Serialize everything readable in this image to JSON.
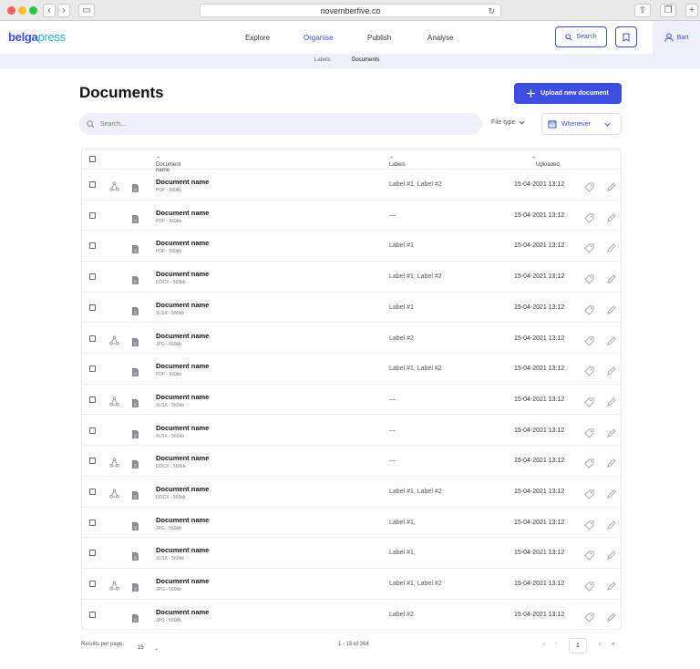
{
  "browser": {
    "url": "novemberfive.co"
  },
  "brand": {
    "part1": "belga",
    "part2": "press"
  },
  "nav": {
    "items": [
      "Explore",
      "Organise",
      "Publish",
      "Analyse"
    ],
    "active": "Organise",
    "search_label": "Search",
    "user": "Bart"
  },
  "subnav": {
    "items": [
      "Labels",
      "Documents"
    ],
    "active": "Documents"
  },
  "page": {
    "title": "Documents",
    "upload_label": "Upload new document",
    "search_placeholder": "Search...",
    "filetype_label": "File type",
    "date_filter": "Whenever"
  },
  "table": {
    "headers": {
      "name": "Document name",
      "labels": "Labels",
      "uploaded": "Uploaded"
    },
    "rows": [
      {
        "name": "Document name",
        "meta": "PDF - 560kb",
        "labels": "Label #1, Label #2",
        "date": "15-04-2021 13:12",
        "shared": true
      },
      {
        "name": "Document name",
        "meta": "PDF - 560kb",
        "labels": "—",
        "date": "15-04-2021 13:12",
        "shared": false
      },
      {
        "name": "Document name",
        "meta": "PDF - 560kb",
        "labels": "Label #1",
        "date": "15-04-2021 13:12",
        "shared": false
      },
      {
        "name": "Document name",
        "meta": "DOCX - 560kb",
        "labels": "Label #1, Label #2",
        "date": "15-04-2021 13:12",
        "shared": false
      },
      {
        "name": "Document name",
        "meta": "XLSX - 560kb",
        "labels": "Label #1",
        "date": "15-04-2021 13:12",
        "shared": false
      },
      {
        "name": "Document name",
        "meta": "JPG - 560kb",
        "labels": "Label #2",
        "date": "15-04-2021 13:12",
        "shared": true
      },
      {
        "name": "Document name",
        "meta": "PDF - 560kb",
        "labels": "Label #1, Label #2",
        "date": "15-04-2021 13:12",
        "shared": false
      },
      {
        "name": "Document name",
        "meta": "XLSX - 560kb",
        "labels": "—",
        "date": "15-04-2021 13:12",
        "shared": true
      },
      {
        "name": "Document name",
        "meta": "XLSX - 560kb",
        "labels": "—",
        "date": "15-04-2021 13:12",
        "shared": false
      },
      {
        "name": "Document name",
        "meta": "DOCX - 560kb",
        "labels": "—",
        "date": "15-04-2021 13:12",
        "shared": true
      },
      {
        "name": "Document name",
        "meta": "DOCX - 560kb",
        "labels": "Label #1, Label #2",
        "date": "15-04-2021 13:12",
        "shared": true
      },
      {
        "name": "Document name",
        "meta": "JPG - 560kb",
        "labels": "Label #1,",
        "date": "15-04-2021 13:12",
        "shared": false
      },
      {
        "name": "Document name",
        "meta": "XLSX - 560kb",
        "labels": "Label #1,",
        "date": "15-04-2021 13:12",
        "shared": false
      },
      {
        "name": "Document name",
        "meta": "JPG - 560kb",
        "labels": "Label #1, Label #2",
        "date": "15-04-2021 13:12",
        "shared": true
      },
      {
        "name": "Document name",
        "meta": "JPG - 560kb",
        "labels": "Label #2",
        "date": "15-04-2021 13:12",
        "shared": false
      }
    ]
  },
  "footer": {
    "results_label": "Results per page:",
    "per_page": "15",
    "range": "1 - 15 of 364",
    "page": "1"
  },
  "colors": {
    "accent": "#3b4ee0"
  }
}
